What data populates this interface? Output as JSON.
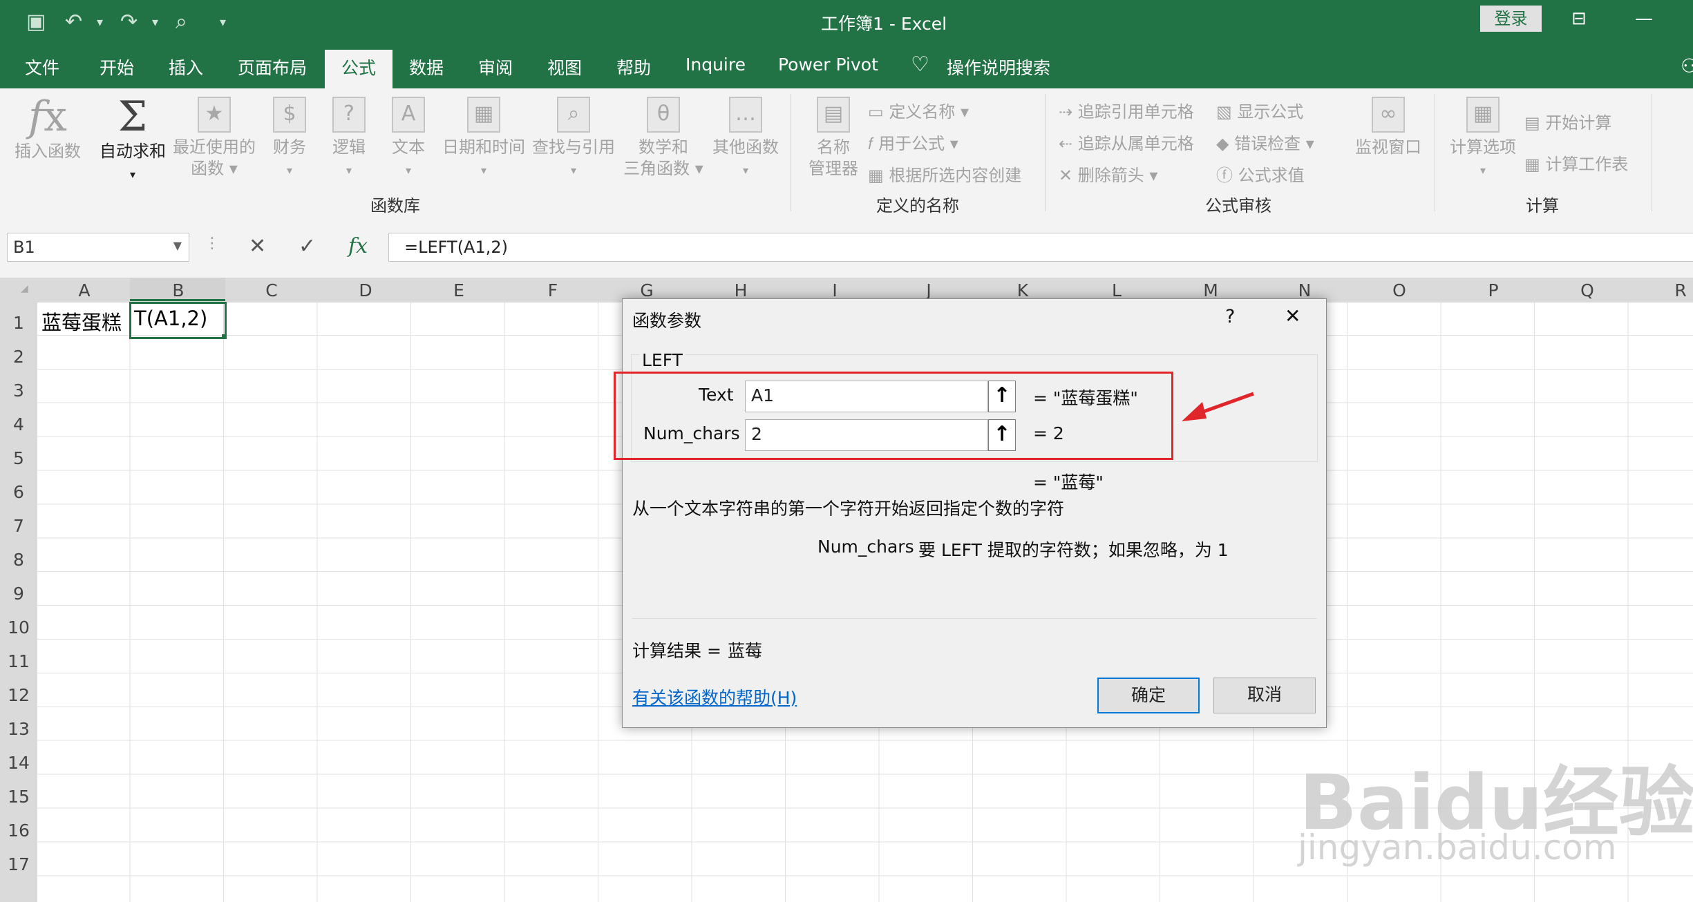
{
  "window": {
    "title": "工作簿1  -  Excel",
    "login_label": "登录"
  },
  "tabs": [
    "文件",
    "开始",
    "插入",
    "页面布局",
    "公式",
    "数据",
    "审阅",
    "视图",
    "帮助",
    "Inquire",
    "Power Pivot"
  ],
  "active_tab": "公式",
  "tell_me": "操作说明搜索",
  "ribbon": {
    "function_library": {
      "insert_function": "插入函数",
      "autosum": "自动求和",
      "recent": [
        "最近使用的",
        "函数"
      ],
      "financial": "财务",
      "logical": "逻辑",
      "text": "文本",
      "datetime": "日期和时间",
      "lookup": "查找与引用",
      "math": [
        "数学和",
        "三角函数"
      ],
      "more": "其他函数",
      "label": "函数库"
    },
    "defined_names": {
      "name_manager": [
        "名称",
        "管理器"
      ],
      "define_name": "定义名称",
      "use_in_formula": "用于公式",
      "create_from_selection": "根据所选内容创建",
      "label": "定义的名称"
    },
    "formula_auditing": {
      "trace_precedents": "追踪引用单元格",
      "trace_dependents": "追踪从属单元格",
      "remove_arrows": "删除箭头",
      "show_formulas": "显示公式",
      "error_checking": "错误检查",
      "evaluate_formula": "公式求值",
      "watch_window": "监视窗口",
      "label": "公式审核"
    },
    "calculation": {
      "options": "计算选项",
      "calc_now": "开始计算",
      "calc_sheet": "计算工作表",
      "label": "计算"
    }
  },
  "formula_bar": {
    "name_box": "B1",
    "fx": "fx",
    "formula": "=LEFT(A1,2)"
  },
  "columns": [
    "A",
    "B",
    "C",
    "D",
    "E",
    "F",
    "G",
    "H",
    "I",
    "J",
    "K",
    "L",
    "M",
    "N",
    "O",
    "P",
    "Q",
    "R"
  ],
  "rows": [
    "1",
    "2",
    "3",
    "4",
    "5",
    "6",
    "7",
    "8",
    "9",
    "10",
    "11",
    "12",
    "13",
    "14",
    "15",
    "16",
    "17"
  ],
  "cells": {
    "A1": "蓝莓蛋糕",
    "B1": "T(A1,2)"
  },
  "dialog": {
    "title": "函数参数",
    "help_mark": "?",
    "close_mark": "✕",
    "function_name": "LEFT",
    "args": [
      {
        "label": "Text",
        "value": "A1",
        "result": "=   \"蓝莓蛋糕\""
      },
      {
        "label": "Num_chars",
        "value": "2",
        "result": "=   2"
      }
    ],
    "overall_result": "=   \"蓝莓\"",
    "description": "从一个文本字符串的第一个字符开始返回指定个数的字符",
    "arg_help_name": "Num_chars",
    "arg_help_text": "要 LEFT 提取的字符数；如果忽略，为 1",
    "calc_result_label": "计算结果 =",
    "calc_result_value": "蓝莓",
    "help_link": "有关该函数的帮助(H)",
    "ok": "确定",
    "cancel": "取消",
    "highlight_color": "#e0252b"
  },
  "watermark": {
    "brand": "Baidu经验",
    "url": "jingyan.baidu.com"
  },
  "colors": {
    "excel_green": "#217346",
    "ribbon_bg": "#f3f3f3",
    "annotation_red": "#e0252b"
  }
}
